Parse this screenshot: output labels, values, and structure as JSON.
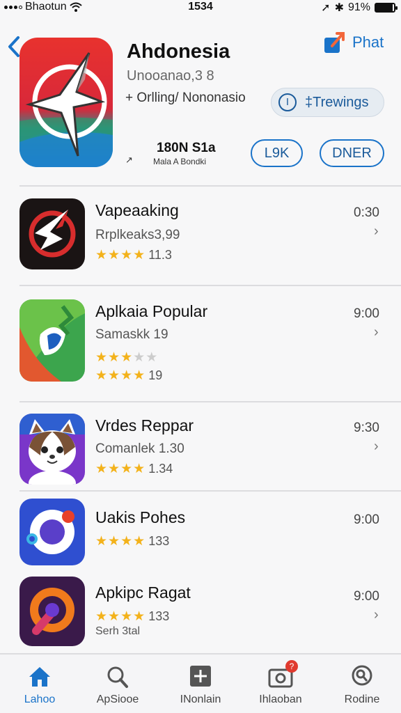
{
  "status_bar": {
    "carrier": "Bhaotun",
    "time": "1534",
    "battery": "91%",
    "battery_level": 0.91
  },
  "header": {
    "title": "Ahdonesia",
    "subtitle": "Unooanao,3 8",
    "category": "Orlling/ Nononasio",
    "category_prefix": "+",
    "share_label": "Phat",
    "trending_label": "‡Trewings",
    "trending_icon": "I",
    "rank_value": "180N S1a",
    "rank_label": "Mala A Bondki",
    "rank_arrow": "↗",
    "button_lok": "L9K",
    "button_dner": "DNER"
  },
  "apps": [
    {
      "title": "Vapeaaking",
      "subtitle": "Rrplkeaks3,99",
      "time": "0:30",
      "rating": 4,
      "rating_text": "11.3",
      "icon": "white-red-arrow-icon",
      "colors": [
        "#1a1414",
        "#d72d2d"
      ]
    },
    {
      "title": "Aplkaia Popular",
      "subtitle": "Samaskk 19",
      "time": "9:00",
      "rating": 3,
      "rating_text": "",
      "rating2": 4,
      "rating2_text": "19",
      "icon": "green-orange-swirl-icon",
      "colors": [
        "#3ca54d",
        "#e2582f"
      ]
    },
    {
      "title": "Vrdes Reppar",
      "subtitle": "Comanlek 1.30",
      "time": "9:30",
      "rating": 4,
      "rating_text": "1.34",
      "icon": "cat-face-icon",
      "colors": [
        "#7a36c9",
        "#ff8a2a"
      ]
    },
    {
      "title": "Uakis Pohes",
      "subtitle": "",
      "time": "9:00",
      "rating": 4,
      "rating_text": "133",
      "icon": "blue-ring-icon",
      "colors": [
        "#2f4fd0",
        "#e8402a"
      ]
    },
    {
      "title": "Apkipc Ragat",
      "subtitle": "",
      "time": "9:00",
      "rating": 4,
      "rating_text": "133",
      "extra": "Serh 3tal",
      "icon": "orange-ring-icon",
      "colors": [
        "#f07a1c",
        "#d63a6a"
      ]
    }
  ],
  "tabs": [
    {
      "label": "Lahoo",
      "icon": "home-icon",
      "active": true
    },
    {
      "label": "ApSiooe",
      "icon": "search-icon",
      "active": false
    },
    {
      "label": "INonlain",
      "icon": "plus-box-icon",
      "active": false
    },
    {
      "label": "Ihlaoban",
      "icon": "camera-badge-icon",
      "active": false,
      "badge": "?"
    },
    {
      "label": "Rodine",
      "icon": "magnifier-circle-icon",
      "active": false
    }
  ],
  "colors": {
    "accent": "#1a73c9",
    "star": "#f3b21b",
    "background": "#f7f7f8"
  }
}
